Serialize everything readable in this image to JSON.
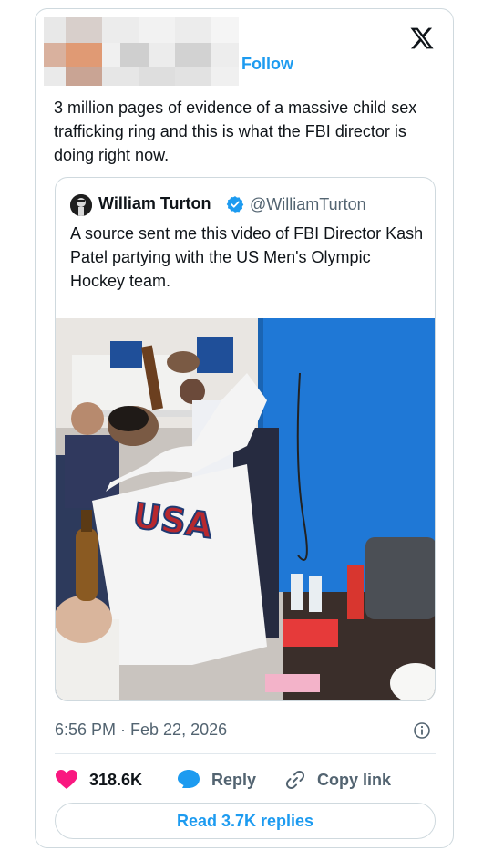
{
  "header": {
    "follow_label": "Follow",
    "logo_icon": "x-logo-icon"
  },
  "tweet": {
    "text": "3 million pages of evidence of a massive child sex trafficking ring and this is what the FBI director is doing right now."
  },
  "quoted_tweet": {
    "author_name": "William Turton",
    "verified": true,
    "handle": "@WilliamTurton",
    "text": "A source sent me this video of FBI Director Kash Patel partying with the US Men's Olympic Hockey team.",
    "media_icon": "video-thumbnail",
    "jersey_text": "USA"
  },
  "meta": {
    "timestamp": "6:56 PM · Feb 22, 2026"
  },
  "actions": {
    "like_count": "318.6K",
    "reply_label": "Reply",
    "copy_link_label": "Copy link"
  },
  "footer": {
    "read_replies_label": "Read 3.7K replies"
  },
  "colors": {
    "accent": "#1d9bf0",
    "like": "#f91880",
    "muted": "#536471",
    "border": "#cfd9de"
  }
}
